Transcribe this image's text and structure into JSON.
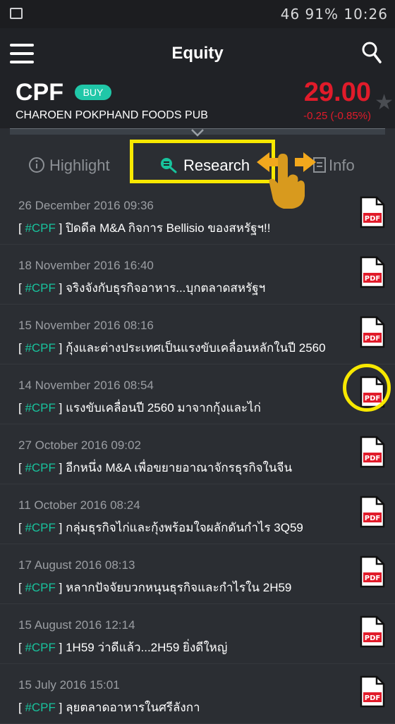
{
  "status_bar": {
    "right_text": "46 91% 10:26"
  },
  "header": {
    "title": "Equity"
  },
  "stock": {
    "ticker": "CPF",
    "badge": "BUY",
    "company": "CHAROEN POKPHAND FOODS PUB",
    "price": "29.00",
    "change": "-0.25 (-0.85%)"
  },
  "tabs": {
    "highlight": "Highlight",
    "research": "Research",
    "info": "Info"
  },
  "research_items": [
    {
      "date": "26 December 2016 09:36",
      "tag": "#CPF",
      "title": "ปิดดีล M&A กิจการ Bellisio ของสหรัฐฯ!!"
    },
    {
      "date": "18 November 2016 16:40",
      "tag": "#CPF",
      "title": "จริงจังกับธุรกิจอาหาร...บุกตลาดสหรัฐฯ"
    },
    {
      "date": "15 November 2016 08:16",
      "tag": "#CPF",
      "title": "กุ้งและต่างประเทศเป็นแรงขับเคลื่อนหลักในปี 2560"
    },
    {
      "date": "14 November 2016 08:54",
      "tag": "#CPF",
      "title": "แรงขับเคลื่อนปี 2560 มาจากกุ้งและไก่"
    },
    {
      "date": "27 October 2016 09:02",
      "tag": "#CPF",
      "title": "อีกหนึ่ง M&A เพื่อขยายอาณาจักรธุรกิจในจีน"
    },
    {
      "date": "11 October 2016 08:24",
      "tag": "#CPF",
      "title": "กลุ่มธุรกิจไก่และกุ้งพร้อมใจผลักดันกำไร 3Q59"
    },
    {
      "date": "17 August 2016 08:13",
      "tag": "#CPF",
      "title": "หลากปัจจัยบวกหนุนธุรกิจและกำไรใน 2H59"
    },
    {
      "date": "15 August 2016 12:14",
      "tag": "#CPF",
      "title": "1H59 ว่าดีแล้ว...2H59 ยิ่งดีใหญ่"
    },
    {
      "date": "15 July 2016 15:01",
      "tag": "#CPF",
      "title": "ลุยตลาดอาหารในศรีลังกา"
    }
  ],
  "pdf_label": "PDF",
  "colors": {
    "accent": "#18c39d",
    "negative": "#e11b2a",
    "highlight": "#f7e800"
  }
}
